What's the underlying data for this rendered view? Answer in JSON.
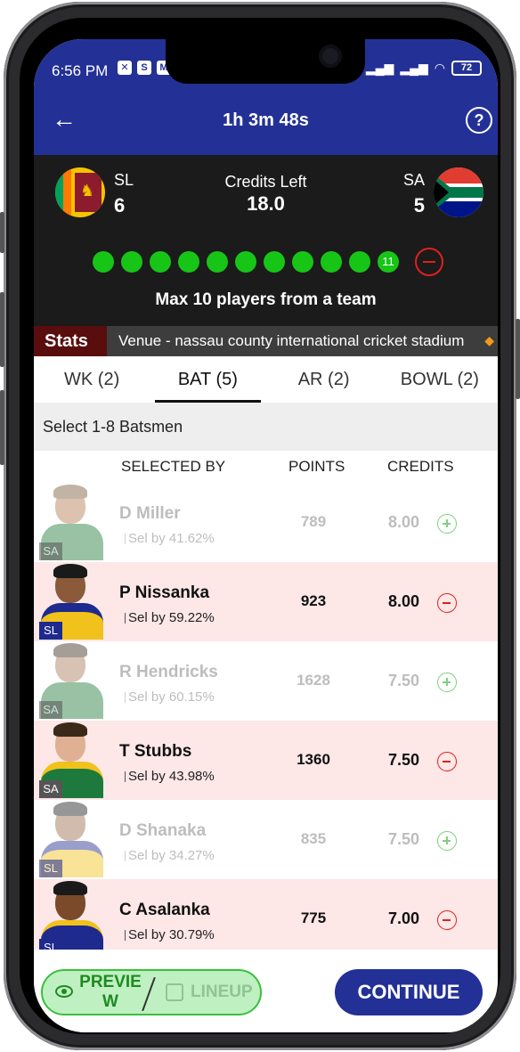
{
  "status_bar": {
    "time": "6:56 PM",
    "battery": "72"
  },
  "header": {
    "title": "1h 3m 48s",
    "help": "?"
  },
  "teams": {
    "left": {
      "code": "SL",
      "count": "6"
    },
    "right": {
      "code": "SA",
      "count": "5"
    },
    "credits_label": "Credits Left",
    "credits_value": "18.0",
    "selected_count_label": "11",
    "max_text": "Max 10 players from a team"
  },
  "stats": {
    "label": "Stats",
    "venue": "Venue - nassau county international cricket stadium"
  },
  "tabs": [
    {
      "label": "WK (2)"
    },
    {
      "label": "BAT (5)"
    },
    {
      "label": "AR (2)"
    },
    {
      "label": "BOWL (2)"
    }
  ],
  "select_hint": "Select 1-8 Batsmen",
  "columns": {
    "selected_by": "SELECTED BY",
    "points": "POINTS",
    "credits": "CREDITS"
  },
  "players": [
    {
      "name": "D Miller",
      "sel": "Sel by 41.62%",
      "points": "789",
      "credits": "8.00",
      "team": "SA",
      "selected": false
    },
    {
      "name": "P Nissanka",
      "sel": "Sel by 59.22%",
      "points": "923",
      "credits": "8.00",
      "team": "SL",
      "selected": true
    },
    {
      "name": "R Hendricks",
      "sel": "Sel by 60.15%",
      "points": "1628",
      "credits": "7.50",
      "team": "SA",
      "selected": false
    },
    {
      "name": "T Stubbs",
      "sel": "Sel by 43.98%",
      "points": "1360",
      "credits": "7.50",
      "team": "SA",
      "selected": true
    },
    {
      "name": "D Shanaka",
      "sel": "Sel by 34.27%",
      "points": "835",
      "credits": "7.50",
      "team": "SL",
      "selected": false
    },
    {
      "name": "C Asalanka",
      "sel": "Sel by 30.79%",
      "points": "775",
      "credits": "7.00",
      "team": "SL",
      "selected": true
    }
  ],
  "footer": {
    "preview": "PREVIE\nW",
    "lineup": "LINEUP",
    "continue": "CONTINUE"
  },
  "colors": {
    "primary": "#233196",
    "selected_row": "#fde7e7",
    "green": "#17c517",
    "red": "#e0201e"
  }
}
